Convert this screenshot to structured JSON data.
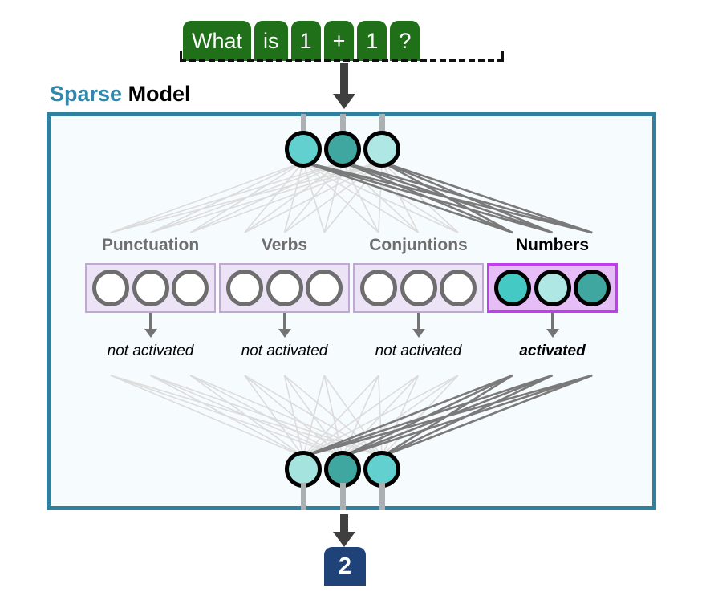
{
  "input": {
    "tokens": [
      "What",
      "is",
      "1",
      "+",
      "1",
      "?"
    ]
  },
  "title": {
    "highlight": "Sparse",
    "rest": " Model",
    "highlight_color": "#3287AA",
    "rest_color": "#000000"
  },
  "model": {
    "border_color": "#2F7F9E",
    "background_color": "#F6FBFD"
  },
  "top_layer": {
    "neurons": [
      {
        "fill": "#62D0CE"
      },
      {
        "fill": "#3FA6A0"
      },
      {
        "fill": "#AEE7E3"
      }
    ]
  },
  "bottom_layer": {
    "neurons": [
      {
        "fill": "#A5E3DE"
      },
      {
        "fill": "#3FA6A0"
      },
      {
        "fill": "#62D0CE"
      }
    ]
  },
  "groups": [
    {
      "label": "Punctuation",
      "active": false,
      "status": "not activated",
      "neurons": [
        {
          "fill": "#FFFFFF"
        },
        {
          "fill": "#FFFFFF"
        },
        {
          "fill": "#FFFFFF"
        }
      ]
    },
    {
      "label": "Verbs",
      "active": false,
      "status": "not activated",
      "neurons": [
        {
          "fill": "#FFFFFF"
        },
        {
          "fill": "#FFFFFF"
        },
        {
          "fill": "#FFFFFF"
        }
      ]
    },
    {
      "label": "Conjuntions",
      "active": false,
      "status": "not activated",
      "neurons": [
        {
          "fill": "#FFFFFF"
        },
        {
          "fill": "#FFFFFF"
        },
        {
          "fill": "#FFFFFF"
        }
      ]
    },
    {
      "label": "Numbers",
      "active": true,
      "status": "activated",
      "neurons": [
        {
          "fill": "#45C9C4"
        },
        {
          "fill": "#AEE7E3"
        },
        {
          "fill": "#3FA6A0"
        }
      ]
    }
  ],
  "output": {
    "value": "2",
    "color": "#1F4379"
  },
  "palette": {
    "token_green": "#1F7018",
    "wire_dim": "#DCDCDC",
    "wire_hot": "#7A7A7A",
    "group_box_dim": "#EDE3F7",
    "group_box_hot": "#E7BDF7",
    "group_border_hot": "#C13DF0"
  }
}
